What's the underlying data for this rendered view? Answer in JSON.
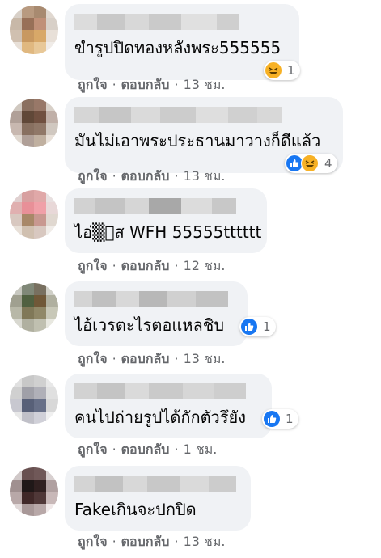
{
  "common": {
    "like_label": "ถูกใจ",
    "reply_label": "ตอบกลับ",
    "dot": "·"
  },
  "comments": [
    {
      "text": "ขำรูปปิดทองหลังพระ555555",
      "reaction_count": "1",
      "time": "13 ชม.",
      "reactions": [
        "haha-icon"
      ]
    },
    {
      "text": "มันไม่เอาพระประธานมาวางก็ดีแล้ว",
      "reaction_count": "4",
      "time": "13 ชม.",
      "reactions": [
        "like-icon",
        "haha-icon"
      ]
    },
    {
      "text": "ไอ่▒ัส WFH 55555tttttt",
      "reaction_count": "",
      "time": "12 ชม.",
      "reactions": []
    },
    {
      "text": "ไอ้เวรตะไรตอแหลชิบ",
      "reaction_count": "1",
      "time": "13 ชม.",
      "reactions": [
        "like-icon"
      ]
    },
    {
      "text": "คนไปถ่ายรูปได้กักตัวรึยัง",
      "reaction_count": "1",
      "time": "1 ชม.",
      "reactions": [
        "like-icon"
      ]
    },
    {
      "text": "Fakeเกินจะปกปิด",
      "reaction_count": "",
      "time": "13 ชม.",
      "reactions": []
    }
  ],
  "colors": {
    "bubble": "#f0f2f5",
    "meta": "#65676b",
    "like_blue": "#1877f2",
    "haha_yellow": "#f7b125"
  }
}
